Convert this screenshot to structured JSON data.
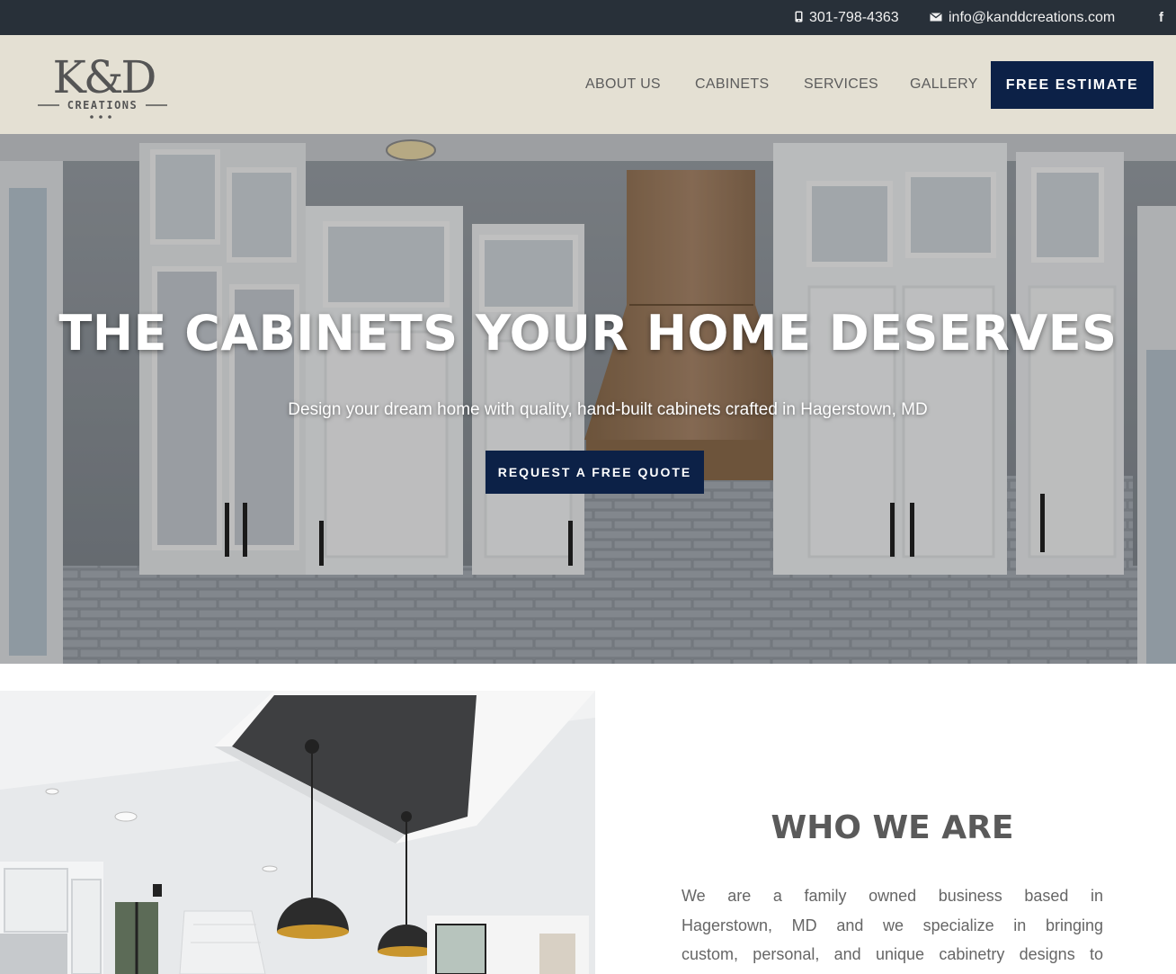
{
  "topbar": {
    "phone_icon": "phone-icon",
    "phone": "301-798-4363",
    "email_icon": "envelope-icon",
    "email": "info@kanddcreations.com",
    "social_icon": "facebook-icon",
    "social_glyph": "f"
  },
  "header": {
    "logo": {
      "letters": "K&D",
      "tagline": "CREATIONS"
    },
    "nav": [
      {
        "label": "ABOUT US"
      },
      {
        "label": "CABINETS"
      },
      {
        "label": "SERVICES"
      },
      {
        "label": "GALLERY"
      }
    ],
    "cta": "FREE ESTIMATE"
  },
  "hero": {
    "title": "THE CABINETS YOUR HOME DESERVES",
    "subtitle": "Design your dream home with quality, hand-built cabinets crafted in Hagerstown, MD",
    "cta": "REQUEST A FREE QUOTE"
  },
  "about": {
    "title": "WHO WE ARE",
    "lines": [
      "We are a family owned business based in",
      "Hagerstown, MD and we specialize in bringing",
      "custom, personal, and unique cabinetry designs to"
    ]
  },
  "colors": {
    "topbar_bg": "#283039",
    "header_bg": "#e4e0d3",
    "brand_navy": "#0c2147",
    "heading_gray": "#5a5a5a"
  }
}
